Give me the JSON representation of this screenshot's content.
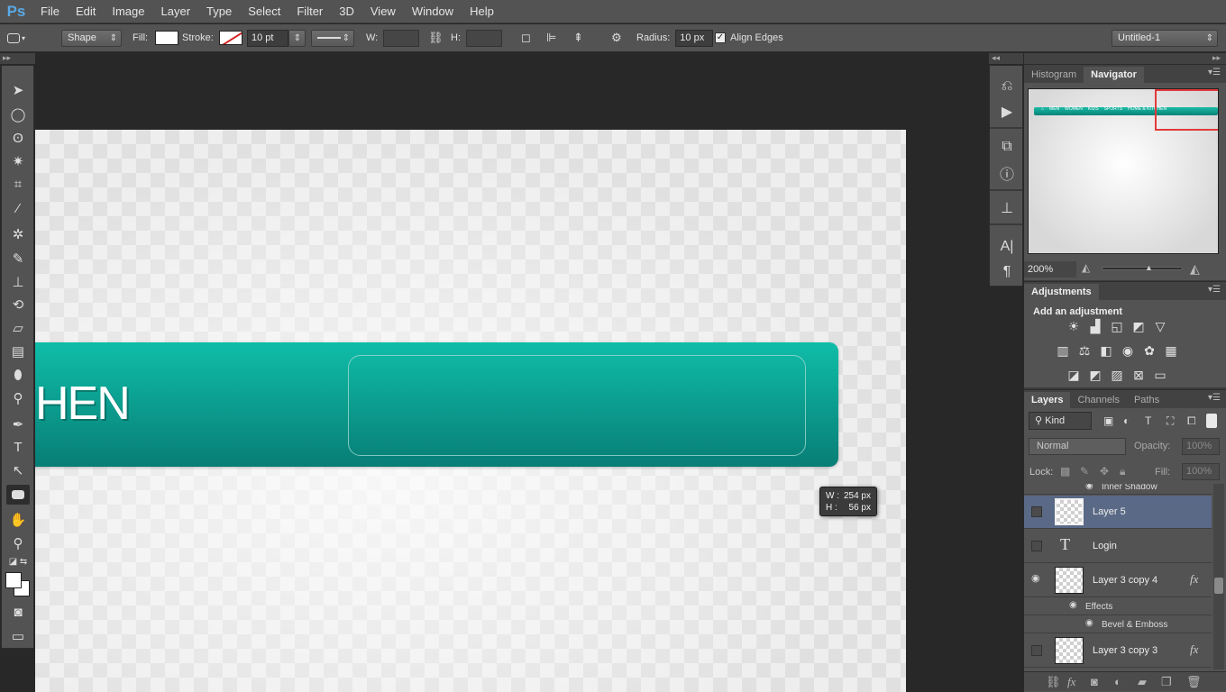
{
  "app": {
    "logo": "Ps"
  },
  "menu": [
    "File",
    "Edit",
    "Image",
    "Layer",
    "Type",
    "Select",
    "Filter",
    "3D",
    "View",
    "Window",
    "Help"
  ],
  "options_bar": {
    "tool_mode": "Shape",
    "fill_label": "Fill:",
    "stroke_label": "Stroke:",
    "stroke_width": "10 pt",
    "w_label": "W:",
    "h_label": "H:",
    "radius_label": "Radius:",
    "radius_value": "10 px",
    "align_edges_label": "Align Edges",
    "align_edges_checked": true,
    "document_select": "Untitled-1"
  },
  "canvas": {
    "nav_text": "HEN",
    "tooltip": {
      "w_label": "W :",
      "w_value": "254 px",
      "h_label": "H :",
      "h_value": "56 px"
    }
  },
  "navigator_panel": {
    "tabs": [
      "Histogram",
      "Navigator"
    ],
    "active_tab": "Navigator",
    "zoom": "200%",
    "preview_menu": [
      "MEN",
      "WOMEN",
      "KIDS",
      "SPORTS",
      "HOME & KITCHEN"
    ]
  },
  "adjustments_panel": {
    "tab": "Adjustments",
    "title": "Add an adjustment"
  },
  "layers_panel": {
    "tabs": [
      "Layers",
      "Channels",
      "Paths"
    ],
    "active_tab": "Layers",
    "filter_kind": "Kind",
    "blend_mode": "Normal",
    "opacity_label": "Opacity:",
    "opacity_value": "100%",
    "lock_label": "Lock:",
    "fill_label": "Fill:",
    "fill_value": "100%",
    "partial_row": "Inner Shadow",
    "layers": [
      {
        "name": "Layer 5",
        "type": "pixel",
        "selected": true,
        "visible": false
      },
      {
        "name": "Login",
        "type": "text",
        "selected": false,
        "visible": false
      },
      {
        "name": "Layer 3 copy 4",
        "type": "pixel",
        "selected": false,
        "visible": true,
        "fx": true
      },
      {
        "name": "Layer 3 copy 3",
        "type": "pixel",
        "selected": false,
        "visible": false,
        "fx": true
      }
    ],
    "effects_label": "Effects",
    "effect_bevel": "Bevel & Emboss"
  },
  "colors": {
    "accent_teal": "#0fbda8",
    "selected_layer": "#5a6986",
    "chrome": "#535353"
  }
}
